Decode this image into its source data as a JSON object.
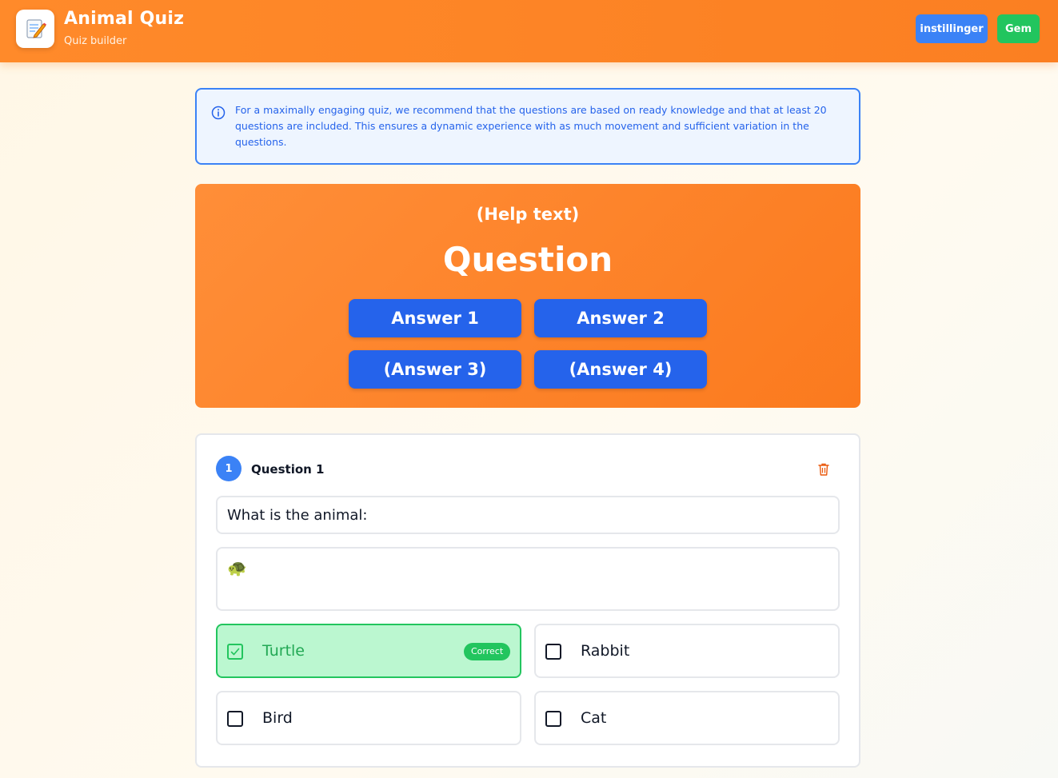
{
  "header": {
    "app_icon": "memo-pencil-icon",
    "title": "Animal Quiz",
    "subtitle": "Quiz builder",
    "settings_label": "instillinger",
    "save_label": "Gem"
  },
  "info": {
    "icon": "info-circle-icon",
    "text": "For a maximally engaging quiz, we recommend that the questions are based on ready knowledge and that at least 20 questions are included. This ensures a dynamic experience with as much movement and sufficient variation in the questions."
  },
  "preview": {
    "help_text": "(Help text)",
    "question": "Question",
    "answers": [
      "Answer 1",
      "Answer 2",
      "(Answer 3)",
      "(Answer 4)"
    ]
  },
  "question_card": {
    "number": "1",
    "label": "Question 1",
    "question_text": "What is the animal:",
    "emoji": "🐢",
    "options": [
      {
        "label": "Turtle",
        "correct": true,
        "badge": "Correct"
      },
      {
        "label": "Rabbit",
        "correct": false
      },
      {
        "label": "Bird",
        "correct": false
      },
      {
        "label": "Cat",
        "correct": false
      }
    ]
  },
  "colors": {
    "header": "#fb7f22",
    "primary": "#2563eb",
    "success": "#22c55e",
    "correct_bg": "#bbf7d0"
  }
}
